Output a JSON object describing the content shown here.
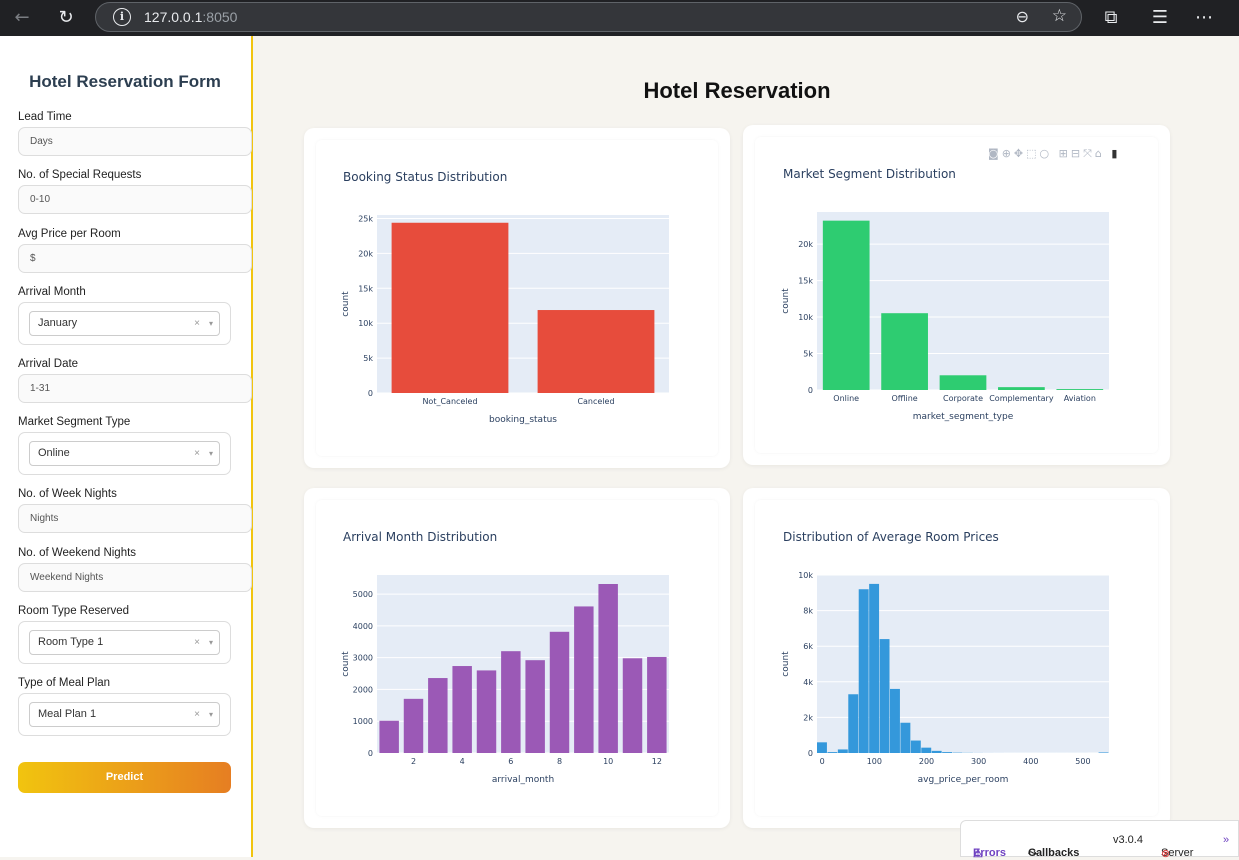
{
  "browser": {
    "url_host": "127.0.0.1",
    "url_port": ":8050"
  },
  "form": {
    "title": "Hotel Reservation Form",
    "lead_time": {
      "label": "Lead Time",
      "placeholder": "Days"
    },
    "special_requests": {
      "label": "No. of Special Requests",
      "placeholder": "0-10"
    },
    "avg_price": {
      "label": "Avg Price per Room",
      "placeholder": "$"
    },
    "arrival_month": {
      "label": "Arrival Month",
      "value": "January"
    },
    "arrival_date": {
      "label": "Arrival Date",
      "placeholder": "1-31"
    },
    "market_segment": {
      "label": "Market Segment Type",
      "value": "Online"
    },
    "week_nights": {
      "label": "No. of Week Nights",
      "placeholder": "Nights"
    },
    "weekend_nights": {
      "label": "No. of Weekend Nights",
      "placeholder": "Weekend Nights"
    },
    "room_type": {
      "label": "Room Type Reserved",
      "value": "Room Type 1"
    },
    "meal_plan": {
      "label": "Type of Meal Plan",
      "value": "Meal Plan 1"
    },
    "predict_label": "Predict",
    "clear_glyph": "×",
    "caret_glyph": "▾"
  },
  "main": {
    "title": "Hotel Reservation"
  },
  "footer": {
    "errors": "Errors",
    "callbacks": "Callbacks",
    "version": "v3.0.4",
    "server": "Server"
  },
  "colors": {
    "booking": "#e74c3c",
    "market": "#2ecc71",
    "month": "#9b59b6",
    "price": "#3498db",
    "accent": "#f1c40f",
    "plot_bg": "#e5ecf6"
  },
  "chart_data": [
    {
      "type": "bar",
      "title": "Booking Status Distribution",
      "xlabel": "booking_status",
      "ylabel": "count",
      "categories": [
        "Not_Canceled",
        "Canceled"
      ],
      "values": [
        24390,
        11885
      ],
      "ylim": [
        0,
        25500
      ],
      "yticks": [
        0,
        5000,
        10000,
        15000,
        20000,
        25000
      ],
      "ytick_labels": [
        "0",
        "5k",
        "10k",
        "15k",
        "20k",
        "25k"
      ]
    },
    {
      "type": "bar",
      "title": "Market Segment Distribution",
      "xlabel": "market_segment_type",
      "ylabel": "count",
      "categories": [
        "Online",
        "Offline",
        "Corporate",
        "Complementary",
        "Aviation"
      ],
      "values": [
        23214,
        10528,
        2017,
        391,
        125
      ],
      "ylim": [
        0,
        24400
      ],
      "yticks": [
        0,
        5000,
        10000,
        15000,
        20000
      ],
      "ytick_labels": [
        "0",
        "5k",
        "10k",
        "15k",
        "20k"
      ]
    },
    {
      "type": "bar",
      "title": "Arrival Month Distribution",
      "xlabel": "arrival_month",
      "ylabel": "count",
      "categories": [
        1,
        2,
        3,
        4,
        5,
        6,
        7,
        8,
        9,
        10,
        11,
        12
      ],
      "values": [
        1014,
        1704,
        2358,
        2736,
        2598,
        3203,
        2920,
        3813,
        4611,
        5317,
        2980,
        3021
      ],
      "xlim": [
        0.5,
        12.5
      ],
      "xticks": [
        2,
        4,
        6,
        8,
        10,
        12
      ],
      "ylim": [
        0,
        5600
      ],
      "yticks": [
        0,
        1000,
        2000,
        3000,
        4000,
        5000
      ],
      "ytick_labels": [
        "0",
        "1000",
        "2000",
        "3000",
        "4000",
        "5000"
      ]
    },
    {
      "type": "bar",
      "title": "Distribution of Average Room Prices",
      "xlabel": "avg_price_per_room",
      "ylabel": "count",
      "bin_width": 20,
      "x": [
        0,
        20,
        40,
        60,
        80,
        100,
        120,
        140,
        160,
        180,
        200,
        220,
        240,
        260,
        280,
        300,
        320,
        340,
        360,
        380,
        400,
        420,
        440,
        460,
        480,
        500,
        520,
        540
      ],
      "values": [
        600,
        50,
        200,
        3300,
        9200,
        9500,
        6400,
        3600,
        1700,
        700,
        300,
        120,
        50,
        20,
        10,
        5,
        3,
        2,
        1,
        1,
        1,
        1,
        1,
        1,
        1,
        1,
        0,
        30
      ],
      "xlim": [
        -10,
        550
      ],
      "xticks": [
        0,
        100,
        200,
        300,
        400,
        500
      ],
      "ylim": [
        0,
        10000
      ],
      "yticks": [
        0,
        2000,
        4000,
        6000,
        8000,
        10000
      ],
      "ytick_labels": [
        "0",
        "2k",
        "4k",
        "6k",
        "8k",
        "10k"
      ]
    }
  ]
}
